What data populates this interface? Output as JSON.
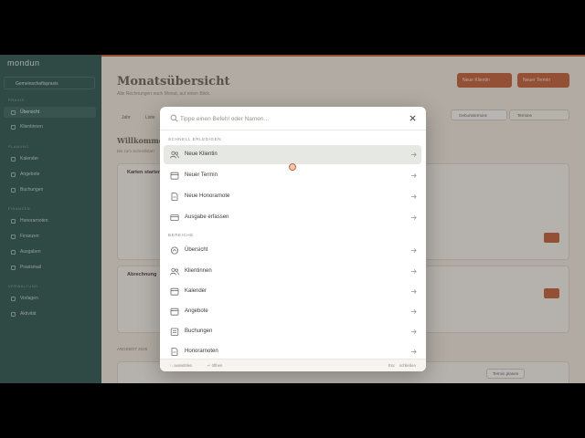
{
  "app": {
    "logo": "mondun",
    "workspace": "Gemeinschaftspraxis"
  },
  "sidebar": {
    "sections": [
      "PRAXIS",
      "PLANUNG",
      "FINANZEN",
      "VERWALTUNG"
    ],
    "items": [
      {
        "label": "Übersicht"
      },
      {
        "label": "Klientinnen"
      },
      {
        "label": "Kalender"
      },
      {
        "label": "Angebote"
      },
      {
        "label": "Buchungen"
      },
      {
        "label": "Honorarnoten"
      },
      {
        "label": "Finanzen"
      },
      {
        "label": "Ausgaben"
      },
      {
        "label": "Praxismail"
      },
      {
        "label": "Vorlagen"
      },
      {
        "label": "Aktivität"
      }
    ]
  },
  "header": {
    "title": "Monatsübersicht",
    "subtitle": "Alle Rechnungen nach Monat, auf einen Blick.",
    "btn_primary": "Neue Klientin",
    "btn_secondary": "Neuer Termin",
    "tabs": [
      "Jahr",
      "Liste"
    ],
    "seg_left": "Geburtstermine",
    "seg_right": "Termine"
  },
  "main": {
    "welcome": "Willkommen",
    "welcome_sub": "Bis zum Schnellstart",
    "card1_title": "Karten starten",
    "card2_title": "Abrechnung",
    "bottom_label": "ANGEBOT 2026",
    "bottom_btn": "Termin planen"
  },
  "palette": {
    "placeholder": "Tippe einen Befehl oder Namen...",
    "group_quick": "SCHNELL ERLEDIGEN",
    "group_areas": "BEREICHE",
    "quick": [
      {
        "label": "Neue Klientin",
        "icon": "users-icon"
      },
      {
        "label": "Neuer Termin",
        "icon": "calendar-icon"
      },
      {
        "label": "Neue Honorarnote",
        "icon": "document-icon"
      },
      {
        "label": "Ausgabe erfassen",
        "icon": "wallet-icon"
      }
    ],
    "areas": [
      {
        "label": "Übersicht",
        "icon": "dashboard-icon"
      },
      {
        "label": "Klientinnen",
        "icon": "users-icon"
      },
      {
        "label": "Kalender",
        "icon": "calendar-icon"
      },
      {
        "label": "Angebote",
        "icon": "calendar-icon"
      },
      {
        "label": "Buchungen",
        "icon": "ledger-icon"
      },
      {
        "label": "Honorarnoten",
        "icon": "document-icon"
      }
    ],
    "footer": {
      "navigate": "↑↓ auswählen",
      "open": "↵ öffnen",
      "esc_key": "Esc",
      "close": "schließen"
    }
  },
  "colors": {
    "accent": "#c9643f",
    "sidebar": "#2f5a57",
    "background": "#f4efe6"
  }
}
